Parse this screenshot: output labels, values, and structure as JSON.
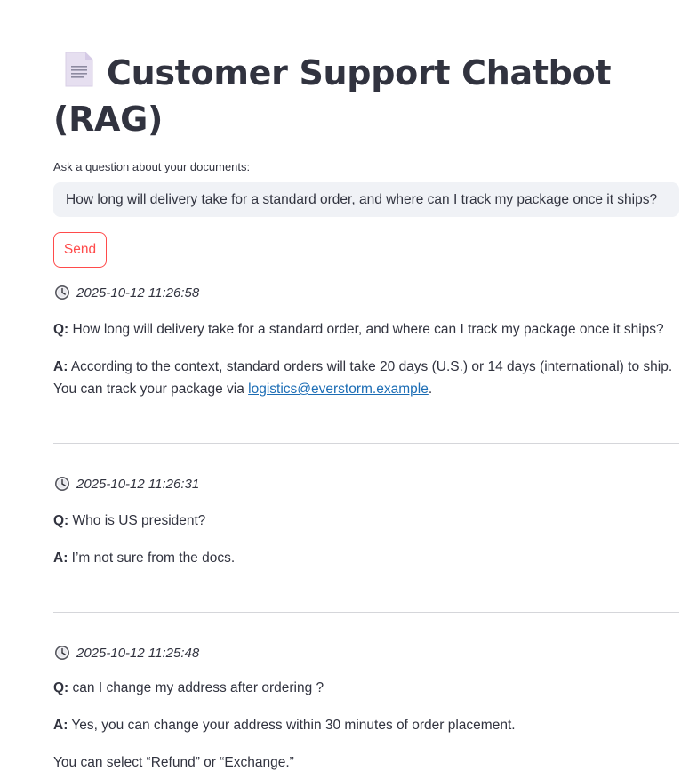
{
  "header": {
    "title": "Customer Support Chatbot (RAG)",
    "icon": "page-document-icon"
  },
  "input": {
    "label": "Ask a question about your documents:",
    "value": "How long will delivery take for a standard order, and where can I track my package once it ships?"
  },
  "send_button": {
    "label": "Send",
    "color": "#ff4b4b"
  },
  "history": [
    {
      "timestamp": "2025-10-12 11:26:58",
      "q_label": "Q:",
      "question": "How long will delivery take for a standard order, and where can I track my package once it ships?",
      "a_label": "A:",
      "answer_pre": "According to the context, standard orders will take 20 days (U.S.) or 14 days (international) to ship. You can track your package via ",
      "answer_link": "logistics@everstorm.example",
      "answer_post": "."
    },
    {
      "timestamp": "2025-10-12 11:26:31",
      "q_label": "Q:",
      "question": "Who is US president?",
      "a_label": "A:",
      "answer": "I’m not sure from the docs."
    },
    {
      "timestamp": "2025-10-12 11:25:48",
      "q_label": "Q:",
      "question": "can I change my address after ordering ?",
      "a_label": "A:",
      "answer": "Yes, you can change your address within 30 minutes of order placement.",
      "followup": "You can select “Refund” or “Exchange.”"
    }
  ],
  "colors": {
    "text": "#31333f",
    "link": "#1c6db5",
    "input_bg": "#f0f2f6",
    "divider": "#d5d6da"
  }
}
